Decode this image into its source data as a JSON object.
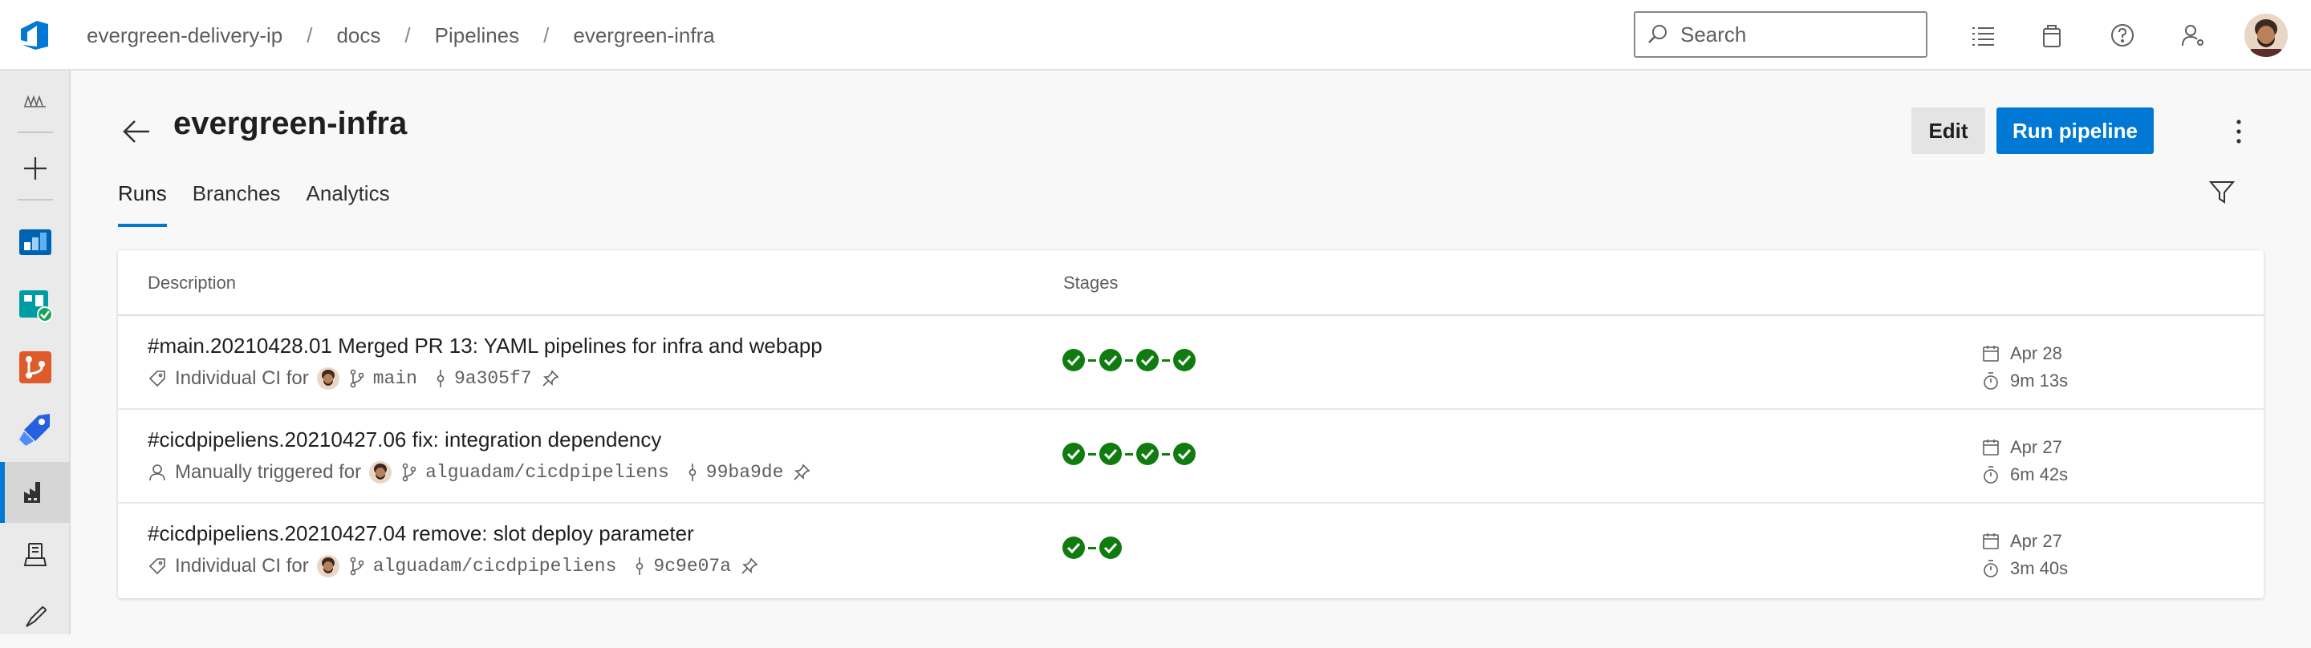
{
  "breadcrumb": [
    "evergreen-delivery-ip",
    "docs",
    "Pipelines",
    "evergreen-infra"
  ],
  "search": {
    "placeholder": "Search"
  },
  "page": {
    "title": "evergreen-infra"
  },
  "actions": {
    "edit_label": "Edit",
    "run_label": "Run pipeline"
  },
  "tabs": [
    {
      "label": "Runs",
      "active": true
    },
    {
      "label": "Branches",
      "active": false
    },
    {
      "label": "Analytics",
      "active": false
    }
  ],
  "table": {
    "headers": {
      "description": "Description",
      "stages": "Stages"
    },
    "rows": [
      {
        "title": "#main.20210428.01 Merged PR 13: YAML pipelines for infra and webapp",
        "trigger": "Individual CI for",
        "trigger_icon": "tag-icon",
        "branch": "main",
        "commit": "9a305f7",
        "stages": [
          "succeeded",
          "succeeded",
          "succeeded",
          "succeeded"
        ],
        "date": "Apr 28",
        "duration": "9m 13s"
      },
      {
        "title": "#cicdpipeliens.20210427.06 fix: integration dependency",
        "trigger": "Manually triggered for",
        "trigger_icon": "person-icon",
        "branch": "alguadam/cicdpipeliens",
        "commit": "99ba9de",
        "stages": [
          "succeeded",
          "succeeded",
          "succeeded",
          "succeeded"
        ],
        "date": "Apr 27",
        "duration": "6m 42s"
      },
      {
        "title": "#cicdpipeliens.20210427.04 remove: slot deploy parameter",
        "trigger": "Individual CI for",
        "trigger_icon": "tag-icon",
        "branch": "alguadam/cicdpipeliens",
        "commit": "9c9e07a",
        "stages": [
          "succeeded",
          "succeeded"
        ],
        "date": "Apr 27",
        "duration": "3m 40s"
      }
    ]
  },
  "colors": {
    "accent": "#0078d4",
    "success": "#107c10"
  }
}
